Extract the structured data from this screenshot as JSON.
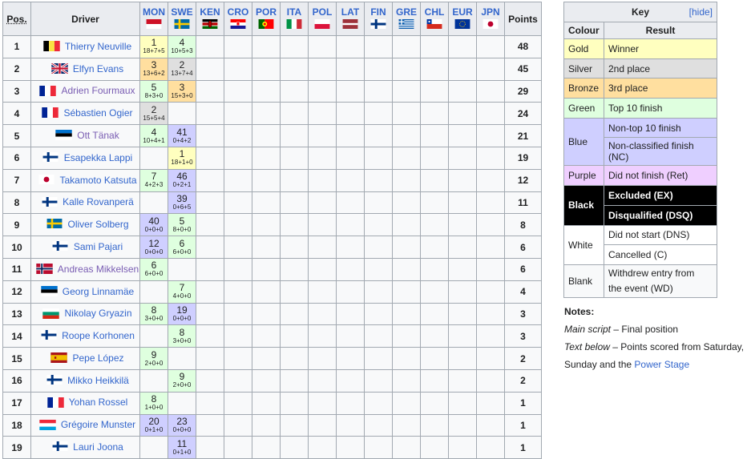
{
  "table": {
    "headers": {
      "pos": "Pos.",
      "driver": "Driver",
      "points": "Points"
    },
    "events": [
      {
        "code": "MON",
        "flag": "mon"
      },
      {
        "code": "SWE",
        "flag": "swe"
      },
      {
        "code": "KEN",
        "flag": "ken"
      },
      {
        "code": "CRO",
        "flag": "cro"
      },
      {
        "code": "POR",
        "flag": "por"
      },
      {
        "code": "ITA",
        "flag": "ita"
      },
      {
        "code": "POL",
        "flag": "pol"
      },
      {
        "code": "LAT",
        "flag": "lat"
      },
      {
        "code": "FIN",
        "flag": "fin"
      },
      {
        "code": "GRE",
        "flag": "gre"
      },
      {
        "code": "CHL",
        "flag": "chl"
      },
      {
        "code": "EUR",
        "flag": "eur"
      },
      {
        "code": "JPN",
        "flag": "jpn"
      }
    ],
    "rows": [
      {
        "pos": "1",
        "driver": "Thierry Neuville",
        "flag": "bel",
        "visited": false,
        "points": "48",
        "results": [
          {
            "p": "1",
            "s": "18+7+5",
            "c": "gold"
          },
          {
            "p": "4",
            "s": "10+5+3",
            "c": "green"
          }
        ]
      },
      {
        "pos": "2",
        "driver": "Elfyn Evans",
        "flag": "gbr",
        "visited": false,
        "points": "45",
        "results": [
          {
            "p": "3",
            "s": "13+6+2",
            "c": "bronze"
          },
          {
            "p": "2",
            "s": "13+7+4",
            "c": "silver"
          }
        ]
      },
      {
        "pos": "3",
        "driver": "Adrien Fourmaux",
        "flag": "fra",
        "visited": true,
        "points": "29",
        "results": [
          {
            "p": "5",
            "s": "8+3+0",
            "c": "green"
          },
          {
            "p": "3",
            "s": "15+3+0",
            "c": "bronze"
          }
        ]
      },
      {
        "pos": "4",
        "driver": "Sébastien Ogier",
        "flag": "fra",
        "visited": false,
        "points": "24",
        "results": [
          {
            "p": "2",
            "s": "15+5+4",
            "c": "silver"
          },
          null
        ]
      },
      {
        "pos": "5",
        "driver": "Ott Tänak",
        "flag": "est",
        "visited": true,
        "points": "21",
        "results": [
          {
            "p": "4",
            "s": "10+4+1",
            "c": "green"
          },
          {
            "p": "41",
            "s": "0+4+2",
            "c": "blue"
          }
        ]
      },
      {
        "pos": "6",
        "driver": "Esapekka Lappi",
        "flag": "fin",
        "visited": false,
        "points": "19",
        "results": [
          null,
          {
            "p": "1",
            "s": "18+1+0",
            "c": "gold"
          }
        ]
      },
      {
        "pos": "7",
        "driver": "Takamoto Katsuta",
        "flag": "jpn",
        "visited": false,
        "points": "12",
        "results": [
          {
            "p": "7",
            "s": "4+2+3",
            "c": "green"
          },
          {
            "p": "46",
            "s": "0+2+1",
            "c": "blue"
          }
        ]
      },
      {
        "pos": "8",
        "driver": "Kalle Rovanperä",
        "flag": "fin",
        "visited": false,
        "points": "11",
        "results": [
          null,
          {
            "p": "39",
            "s": "0+6+5",
            "c": "blue"
          }
        ]
      },
      {
        "pos": "9",
        "driver": "Oliver Solberg",
        "flag": "swe",
        "visited": false,
        "points": "8",
        "results": [
          {
            "p": "40",
            "s": "0+0+0",
            "c": "blue"
          },
          {
            "p": "5",
            "s": "8+0+0",
            "c": "green"
          }
        ]
      },
      {
        "pos": "10",
        "driver": "Sami Pajari",
        "flag": "fin",
        "visited": false,
        "points": "6",
        "results": [
          {
            "p": "12",
            "s": "0+0+0",
            "c": "blue"
          },
          {
            "p": "6",
            "s": "6+0+0",
            "c": "green"
          }
        ]
      },
      {
        "pos": "11",
        "driver": "Andreas Mikkelsen",
        "flag": "nor",
        "visited": true,
        "points": "6",
        "results": [
          {
            "p": "6",
            "s": "6+0+0",
            "c": "green"
          },
          null
        ]
      },
      {
        "pos": "12",
        "driver": "Georg Linnamäe",
        "flag": "est",
        "visited": false,
        "points": "4",
        "results": [
          null,
          {
            "p": "7",
            "s": "4+0+0",
            "c": "green"
          }
        ]
      },
      {
        "pos": "13",
        "driver": "Nikolay Gryazin",
        "flag": "bul",
        "visited": false,
        "points": "3",
        "results": [
          {
            "p": "8",
            "s": "3+0+0",
            "c": "green"
          },
          {
            "p": "19",
            "s": "0+0+0",
            "c": "blue"
          }
        ]
      },
      {
        "pos": "14",
        "driver": "Roope Korhonen",
        "flag": "fin",
        "visited": false,
        "points": "3",
        "results": [
          null,
          {
            "p": "8",
            "s": "3+0+0",
            "c": "green"
          }
        ]
      },
      {
        "pos": "15",
        "driver": "Pepe López",
        "flag": "esp",
        "visited": false,
        "points": "2",
        "results": [
          {
            "p": "9",
            "s": "2+0+0",
            "c": "green"
          },
          null
        ]
      },
      {
        "pos": "16",
        "driver": "Mikko Heikkilä",
        "flag": "fin",
        "visited": false,
        "points": "2",
        "results": [
          null,
          {
            "p": "9",
            "s": "2+0+0",
            "c": "green"
          }
        ]
      },
      {
        "pos": "17",
        "driver": "Yohan Rossel",
        "flag": "fra",
        "visited": false,
        "points": "1",
        "results": [
          {
            "p": "8",
            "s": "1+0+0",
            "c": "green"
          },
          null
        ]
      },
      {
        "pos": "18",
        "driver": "Grégoire Munster",
        "flag": "lux",
        "visited": false,
        "points": "1",
        "results": [
          {
            "p": "20",
            "s": "0+1+0",
            "c": "blue"
          },
          {
            "p": "23",
            "s": "0+0+0",
            "c": "blue"
          }
        ]
      },
      {
        "pos": "19",
        "driver": "Lauri Joona",
        "flag": "fin",
        "visited": false,
        "points": "1",
        "results": [
          null,
          {
            "p": "11",
            "s": "0+1+0",
            "c": "blue"
          }
        ]
      }
    ]
  },
  "key": {
    "title": "Key",
    "hide_label": "[hide]",
    "col_colour": "Colour",
    "col_result": "Result",
    "gold": "Gold",
    "winner": "Winner",
    "silver": "Silver",
    "second": "2nd place",
    "bronze": "Bronze",
    "third": "3rd place",
    "green": "Green",
    "top10": "Top 10 finish",
    "blue": "Blue",
    "nontop10": "Non-top 10 finish",
    "nc": "Non-classified finish (NC)",
    "purple": "Purple",
    "ret": "Did not finish (Ret)",
    "black": "Black",
    "ex": "Excluded (EX)",
    "dsq": "Disqualified (DSQ)",
    "white": "White",
    "dns": "Did not start (DNS)",
    "cancelled": "Cancelled (C)",
    "blank": "Blank",
    "wd1": "Withdrew entry from",
    "wd2": "the event (WD)"
  },
  "notes": {
    "title": "Notes:",
    "l1_i": "Main script",
    "l1": " – Final position",
    "l2_i": "Text below",
    "l2": " – Points scored from Saturday,",
    "l3": "Sunday and the ",
    "l3_link": "Power Stage"
  },
  "colors": {
    "gold": "#ffffbf",
    "silver": "#dfdfdf",
    "bronze": "#ffdf9f",
    "green": "#dfffdf",
    "blue": "#cfcfff",
    "purple": "#efcfff",
    "black": "#000000",
    "link": "#3366cc",
    "visited": "#795cb2"
  }
}
